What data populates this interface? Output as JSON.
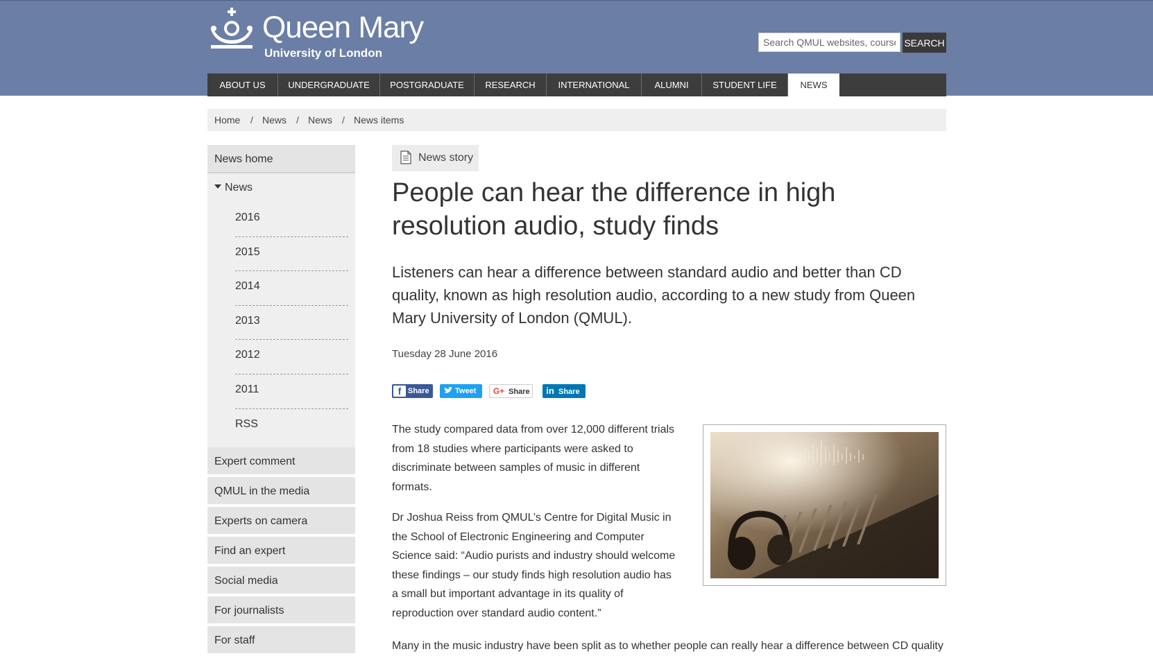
{
  "header": {
    "logo_title": "Queen Mary",
    "logo_subtitle": "University of London",
    "search_placeholder": "Search QMUL websites, courses",
    "search_button": "SEARCH"
  },
  "nav": [
    {
      "label": "ABOUT US"
    },
    {
      "label": "UNDERGRADUATE"
    },
    {
      "label": "POSTGRADUATE"
    },
    {
      "label": "RESEARCH"
    },
    {
      "label": "INTERNATIONAL"
    },
    {
      "label": "ALUMNI"
    },
    {
      "label": "STUDENT LIFE"
    },
    {
      "label": "NEWS",
      "active": true
    }
  ],
  "breadcrumb": [
    "Home",
    "News",
    "News",
    "News items"
  ],
  "sidebar": {
    "top": "News home",
    "section": "News",
    "subitems": [
      "2016",
      "2015",
      "2014",
      "2013",
      "2012",
      "2011",
      "RSS"
    ],
    "items": [
      "Expert comment",
      "QMUL in the media",
      "Experts on camera",
      "Find an expert",
      "Social media",
      "For journalists",
      "For staff"
    ]
  },
  "article": {
    "content_type": "News story",
    "title": "People can hear the difference in high resolution audio, study finds",
    "lead": "Listeners can hear a difference between standard audio and better than CD quality, known as high resolution audio, according to a new study from Queen Mary University of London (QMUL).",
    "date": "Tuesday 28 June 2016",
    "share": {
      "facebook": "Share",
      "twitter": "Tweet",
      "google": "Share",
      "linkedin": "Share"
    },
    "paragraphs": [
      "The study compared data from over 12,000 different trials from 18 studies where participants were asked to discriminate between samples of music in different formats.",
      "Dr Joshua Reiss from QMUL’s Centre for Digital Music in the School of Electronic Engineering and Computer Science said: “Audio purists and industry should welcome these findings – our study finds high resolution audio has a small but important advantage in its quality of reproduction over standard audio content.”",
      "Many in the music industry have been split as to whether people can really hear a difference between CD quality"
    ]
  },
  "colors": {
    "header_bg": "#6b7ea6",
    "nav_bg": "#3d3d3d",
    "sidebar_bg": "#e4e4e4"
  }
}
